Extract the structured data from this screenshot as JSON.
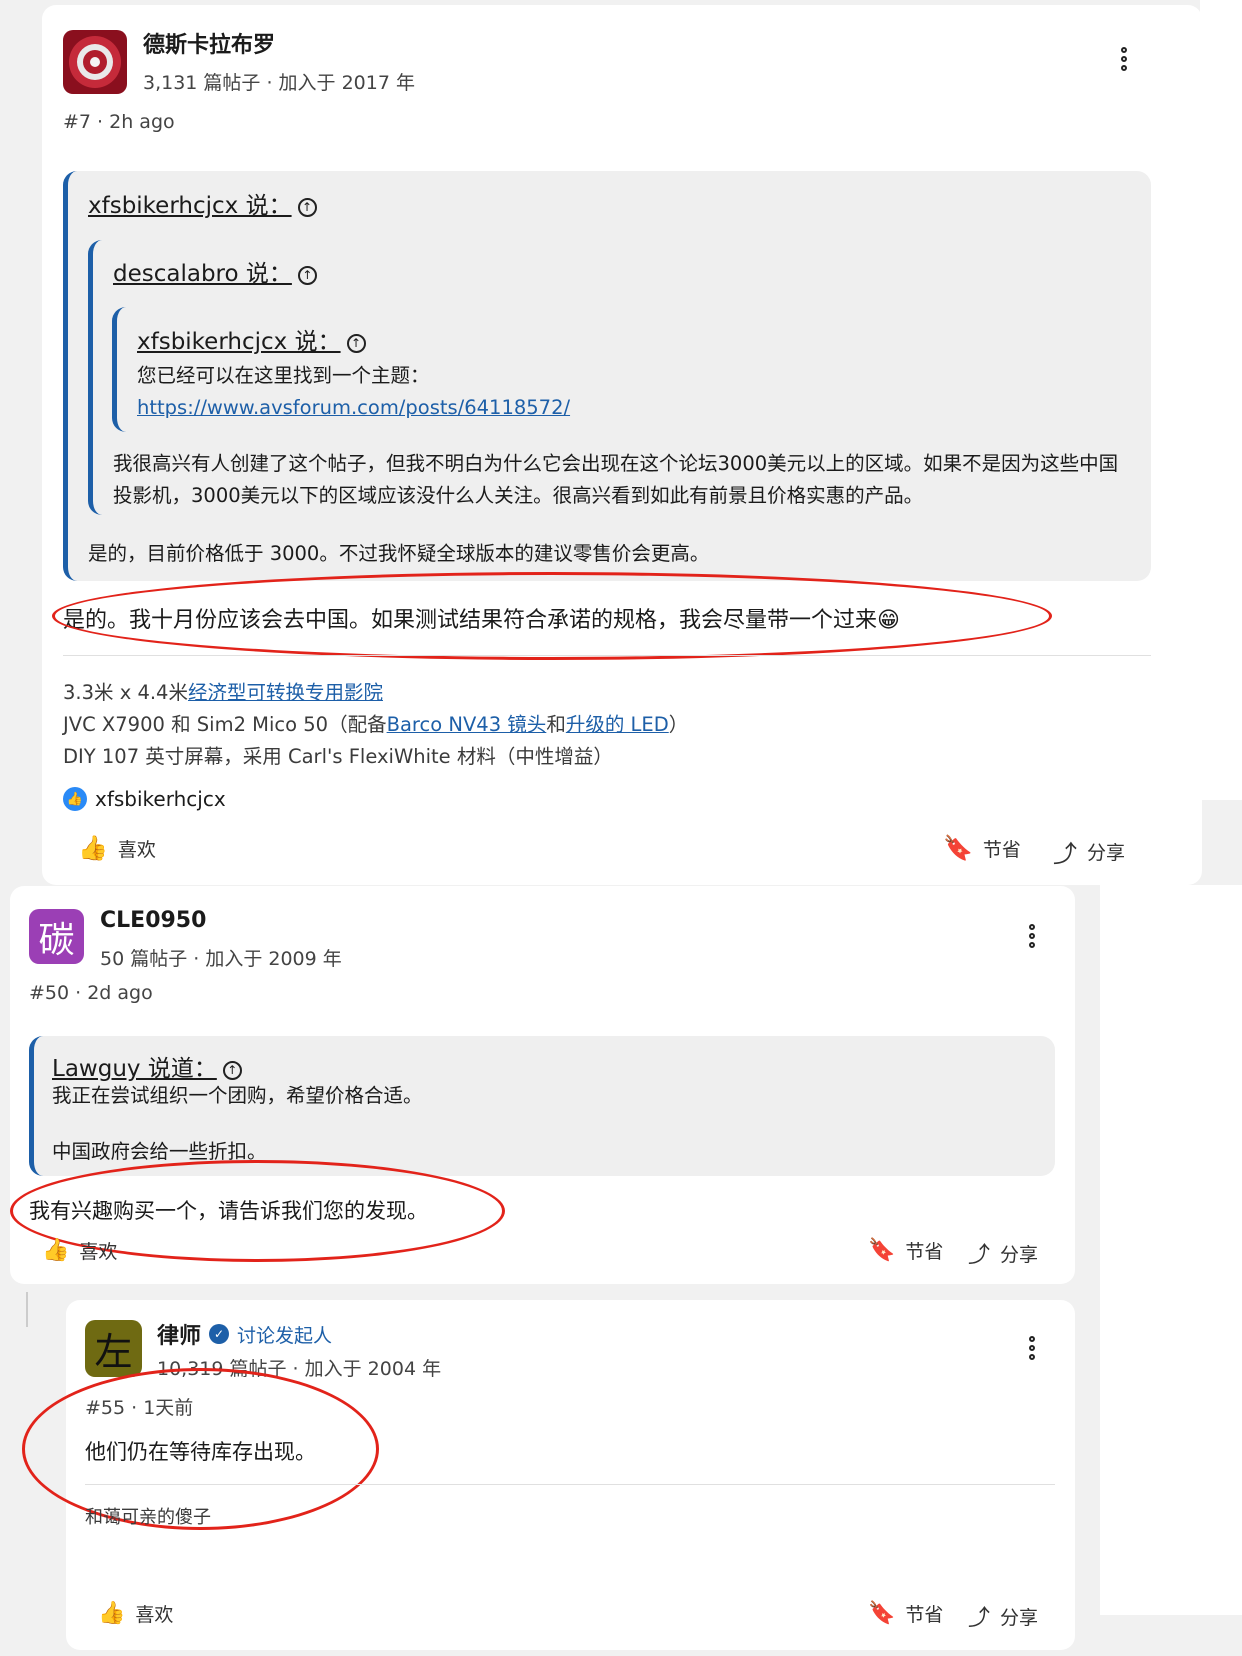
{
  "post1": {
    "username": "德斯卡拉布罗",
    "meta": "3,131 篇帖子 · 加入于 2017 年",
    "postnum": "#7 · 2h ago",
    "quote_outer_author": "xfsbikerhcjcx 说：",
    "quote_mid_author": "descalabro 说：",
    "quote_inner_author": "xfsbikerhcjcx 说：",
    "quote_inner_text": "您已经可以在这里找到一个主题：",
    "quote_inner_link": "https://www.avsforum.com/posts/64118572/",
    "quote_mid_text": "我很高兴有人创建了这个帖子，但我不明白为什么它会出现在这个论坛3000美元以上的区域。如果不是因为这些中国投影机，3000美元以下的区域应该没什么人关注。很高兴看到如此有前景且价格实惠的产品。",
    "quote_outer_text": "是的，目前价格低于 3000。不过我怀疑全球版本的建议零售价会更高。",
    "body": "是的。我十月份应该会去中国。如果测试结果符合承诺的规格，我会尽量带一个过来",
    "emoji": "😁",
    "sig_line1_a": "3.3米 x 4.4米",
    "sig_line1_link": "经济型可转换专用影院",
    "sig_line2_a": "JVC X7900 和 Sim2 Mico 50（配备",
    "sig_line2_link1": "Barco NV43 镜头",
    "sig_line2_b": "和",
    "sig_line2_link2": "升级的 LED",
    "sig_line2_c": "）",
    "sig_line3": "DIY 107 英寸屏幕，采用 Carl's FlexiWhite 材料（中性增益）",
    "reaction_user": "xfsbikerhcjcx",
    "like": "喜欢",
    "save": "节省",
    "share": "分享"
  },
  "post2": {
    "avatar_char": "碳",
    "username": "CLE0950",
    "meta": "50 篇帖子 · 加入于 2009 年",
    "postnum": "#50 · 2d ago",
    "quote_author": "Lawguy 说道：",
    "quote_line1": "我正在尝试组织一个团购，希望价格合适。",
    "quote_line2": "中国政府会给一些折扣。",
    "body": "我有兴趣购买一个，请告诉我们您的发现。",
    "like": "喜欢",
    "save": "节省",
    "share": "分享"
  },
  "post3": {
    "avatar_char": "左",
    "username": "律师",
    "badge": "讨论发起人",
    "meta": "10,319 篇帖子 · 加入于 2004 年",
    "postnum": "#55 · 1天前",
    "body": "他们仍在等待库存出现。",
    "sig": "和蔼可亲的傻子",
    "like": "喜欢",
    "save": "节省",
    "share": "分享"
  },
  "colors": {
    "accent": "#1d5fa8",
    "annotation": "#e2231a",
    "avatar2": "#9b3fb5",
    "avatar3": "#6f6a12"
  }
}
